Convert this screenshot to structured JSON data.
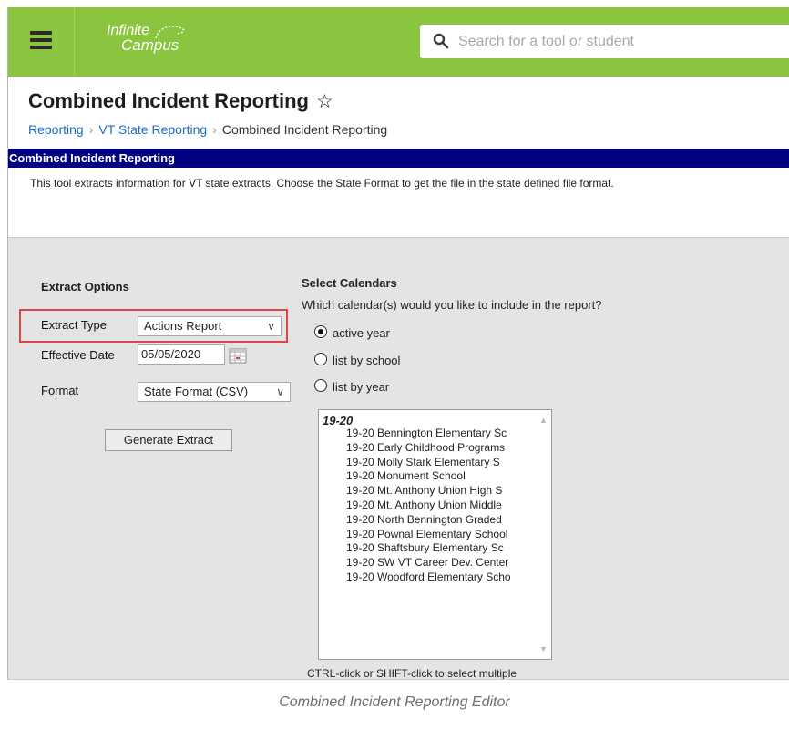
{
  "topbar": {
    "logo_line1": "Infinite",
    "logo_line2": "Campus",
    "search_placeholder": "Search for a tool or student",
    "color": "#8bc53f"
  },
  "page": {
    "title": "Combined Incident Reporting",
    "breadcrumb": [
      "Reporting",
      "VT State Reporting",
      "Combined Incident Reporting"
    ],
    "titlebar": "Combined Incident Reporting",
    "description": "This tool extracts information for VT state extracts. Choose the State Format to get the file in the state defined file format."
  },
  "extract_options": {
    "heading": "Extract Options",
    "extract_type_label": "Extract Type",
    "extract_type_value": "Actions Report",
    "effective_date_label": "Effective Date",
    "effective_date_value": "05/05/2020",
    "format_label": "Format",
    "format_value": "State Format (CSV)",
    "generate_button": "Generate Extract"
  },
  "calendars": {
    "heading": "Select Calendars",
    "question": "Which calendar(s) would you like to include in the report?",
    "radios": [
      "active year",
      "list by school",
      "list by year"
    ],
    "selected_radio": "active year",
    "group": "19-20",
    "options": [
      "19-20 Bennington Elementary Sc",
      "19-20 Early Childhood Programs",
      "19-20 Molly Stark Elementary S",
      "19-20 Monument School",
      "19-20 Mt. Anthony Union High S",
      "19-20 Mt. Anthony Union Middle",
      "19-20 North Bennington Graded",
      "19-20 Pownal Elementary School",
      "19-20 Shaftsbury Elementary Sc",
      "19-20 SW VT Career Dev. Center",
      "19-20 Woodford Elementary Scho"
    ],
    "hint": "CTRL-click or SHIFT-click to select multiple"
  },
  "caption": "Combined Incident Reporting Editor",
  "colors": {
    "titlebar": "#000080",
    "link": "#1c6ac8",
    "highlight": "#e04545"
  }
}
